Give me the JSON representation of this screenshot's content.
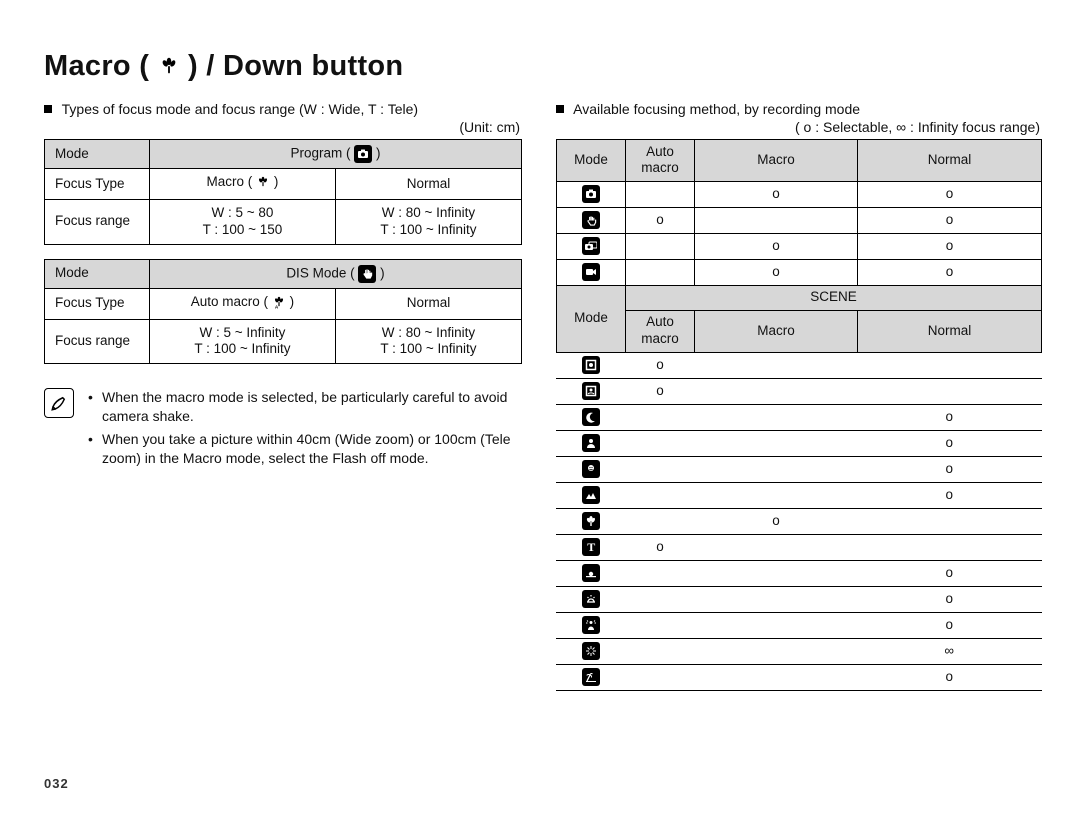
{
  "title_pre": "Macro (",
  "title_post": ") / Down button",
  "page_number": "032",
  "left": {
    "heading": "Types of focus mode and focus range (W : Wide, T : Tele)",
    "unit": "(Unit: cm)",
    "t1": {
      "mode_label": "Mode",
      "mode_value": "Program (",
      "mode_value_post": ")",
      "ftype_label": "Focus Type",
      "ftype_a": "Macro (",
      "ftype_a_post": ")",
      "ftype_b": "Normal",
      "frange_label": "Focus range",
      "r1a_l1": "W : 5 ~ 80",
      "r1a_l2": "T : 100 ~ 150",
      "r1b_l1": "W : 80 ~ Infinity",
      "r1b_l2": "T : 100 ~ Infinity"
    },
    "t2": {
      "mode_label": "Mode",
      "mode_value": "DIS Mode (",
      "mode_value_post": ")",
      "ftype_label": "Focus Type",
      "ftype_a": "Auto macro (",
      "ftype_a_post": ")",
      "ftype_b": "Normal",
      "frange_label": "Focus range",
      "r1a_l1": "W : 5 ~ Infinity",
      "r1a_l2": "T : 100 ~ Infinity",
      "r1b_l1": "W : 80 ~ Infinity",
      "r1b_l2": "T : 100 ~ Infinity"
    },
    "notes": {
      "n1": "When the macro mode is selected, be particularly careful to avoid camera shake.",
      "n2": "When you take a picture within 40cm (Wide zoom) or 100cm (Tele zoom) in the Macro mode, select the Flash off mode."
    }
  },
  "right": {
    "heading": "Available focusing method, by recording mode",
    "legend": "( o : Selectable, ∞ : Infinity focus range)",
    "hdr_mode": "Mode",
    "hdr_auto": "Auto macro",
    "hdr_macro": "Macro",
    "hdr_normal": "Normal",
    "scene_label": "SCENE",
    "rows_top": [
      {
        "icon": "camera-auto-icon",
        "am": "",
        "mc": "o",
        "nm": "o"
      },
      {
        "icon": "hand-icon",
        "am": "o",
        "mc": "",
        "nm": "o"
      },
      {
        "icon": "dual-camera-icon",
        "am": "",
        "mc": "o",
        "nm": "o"
      },
      {
        "icon": "movie-icon",
        "am": "",
        "mc": "o",
        "nm": "o"
      }
    ],
    "rows_scene": [
      {
        "icon": "frame-guide-icon",
        "am": "o",
        "mc": "",
        "nm": ""
      },
      {
        "icon": "beauty-icon",
        "am": "o",
        "mc": "",
        "nm": ""
      },
      {
        "icon": "night-icon",
        "am": "",
        "mc": "",
        "nm": "o"
      },
      {
        "icon": "portrait-icon",
        "am": "",
        "mc": "",
        "nm": "o"
      },
      {
        "icon": "children-icon",
        "am": "",
        "mc": "",
        "nm": "o"
      },
      {
        "icon": "landscape-icon",
        "am": "",
        "mc": "",
        "nm": "o"
      },
      {
        "icon": "closeup-icon",
        "am": "",
        "mc": "o",
        "nm": ""
      },
      {
        "icon": "text-icon",
        "am": "o",
        "mc": "",
        "nm": ""
      },
      {
        "icon": "sunset-icon",
        "am": "",
        "mc": "",
        "nm": "o"
      },
      {
        "icon": "dawn-icon",
        "am": "",
        "mc": "",
        "nm": "o"
      },
      {
        "icon": "backlight-icon",
        "am": "",
        "mc": "",
        "nm": "o"
      },
      {
        "icon": "firework-icon",
        "am": "",
        "mc": "",
        "nm": "∞"
      },
      {
        "icon": "beach-snow-icon",
        "am": "",
        "mc": "",
        "nm": "o"
      }
    ]
  }
}
